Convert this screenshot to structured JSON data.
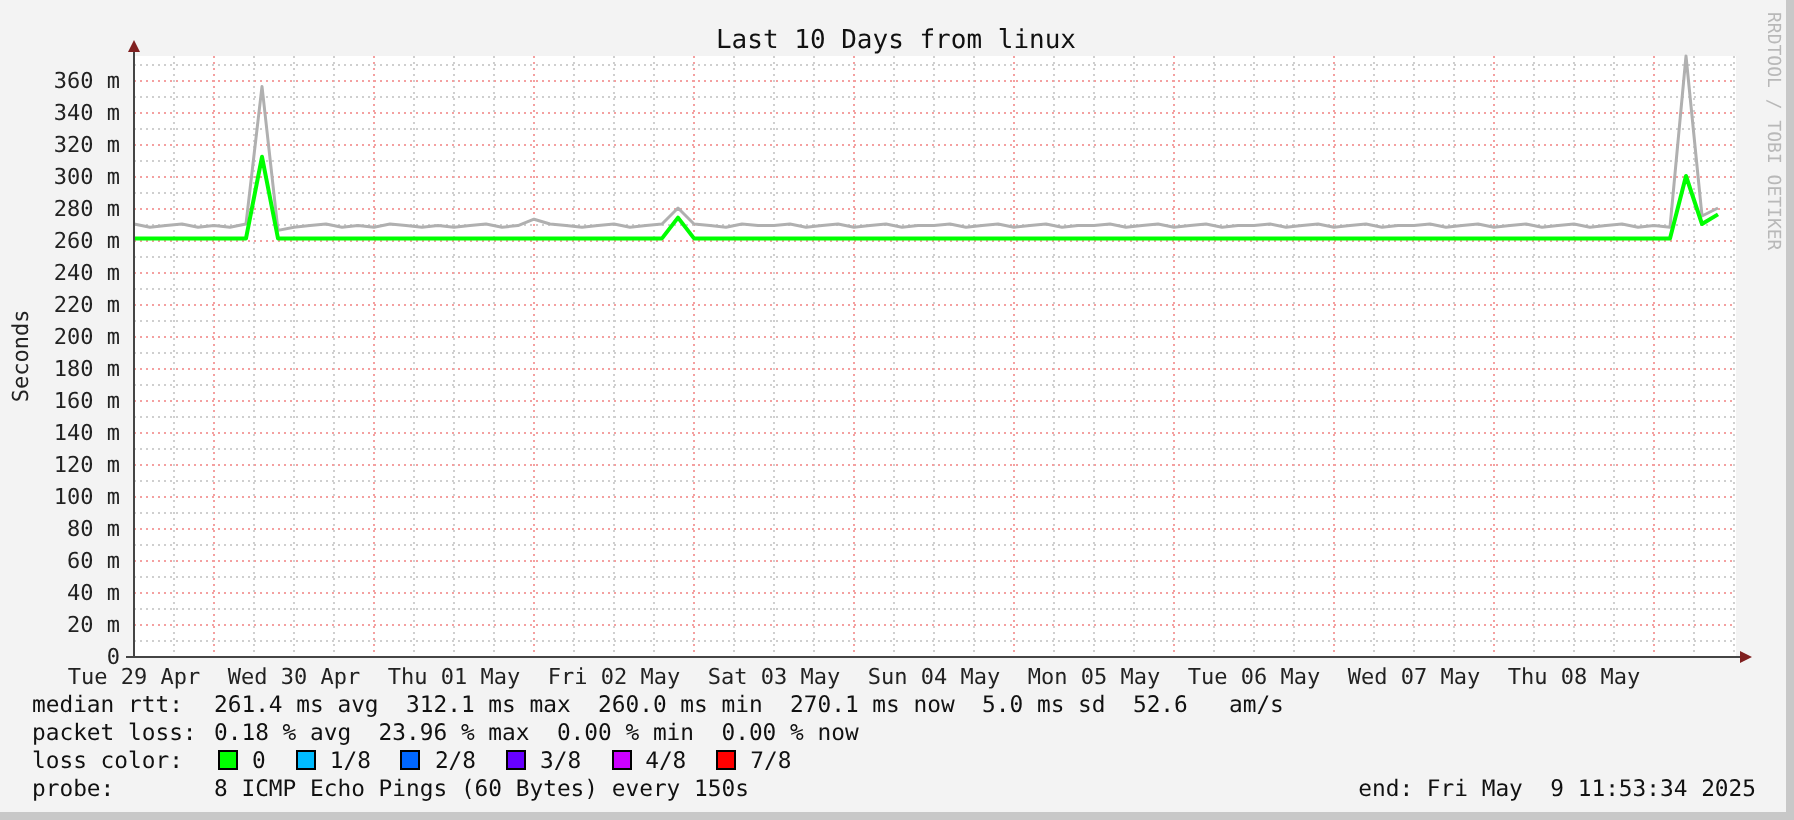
{
  "title": "Last 10 Days from linux",
  "side_label": "RRDTOOL / TOBI OETIKER",
  "chart": {
    "chart_data": {
      "type": "line",
      "grid": true,
      "ylabel": "Seconds",
      "ylim": [
        0,
        375
      ],
      "yticks": [
        {
          "value": 0,
          "label": "0"
        },
        {
          "value": 20,
          "label": "20 m"
        },
        {
          "value": 40,
          "label": "40 m"
        },
        {
          "value": 60,
          "label": "60 m"
        },
        {
          "value": 80,
          "label": "80 m"
        },
        {
          "value": 100,
          "label": "100 m"
        },
        {
          "value": 120,
          "label": "120 m"
        },
        {
          "value": 140,
          "label": "140 m"
        },
        {
          "value": 160,
          "label": "160 m"
        },
        {
          "value": 180,
          "label": "180 m"
        },
        {
          "value": 200,
          "label": "200 m"
        },
        {
          "value": 220,
          "label": "220 m"
        },
        {
          "value": 240,
          "label": "240 m"
        },
        {
          "value": 260,
          "label": "260 m"
        },
        {
          "value": 280,
          "label": "280 m"
        },
        {
          "value": 300,
          "label": "300 m"
        },
        {
          "value": 320,
          "label": "320 m"
        },
        {
          "value": 340,
          "label": "340 m"
        },
        {
          "value": 360,
          "label": "360 m"
        }
      ],
      "categories": [
        "Tue 29 Apr",
        null,
        null,
        null,
        null,
        null,
        null,
        null,
        null,
        null,
        "Wed 30 Apr",
        null,
        null,
        null,
        null,
        null,
        null,
        null,
        null,
        null,
        "Thu 01 May",
        null,
        null,
        null,
        null,
        null,
        null,
        null,
        null,
        null,
        "Fri 02 May",
        null,
        null,
        null,
        null,
        null,
        null,
        null,
        null,
        null,
        "Sat 03 May",
        null,
        null,
        null,
        null,
        null,
        null,
        null,
        null,
        null,
        "Sun 04 May",
        null,
        null,
        null,
        null,
        null,
        null,
        null,
        null,
        null,
        "Mon 05 May",
        null,
        null,
        null,
        null,
        null,
        null,
        null,
        null,
        null,
        "Tue 06 May",
        null,
        null,
        null,
        null,
        null,
        null,
        null,
        null,
        null,
        "Wed 07 May",
        null,
        null,
        null,
        null,
        null,
        null,
        null,
        null,
        null,
        "Thu 08 May",
        null,
        null,
        null,
        null,
        null,
        null,
        null,
        null,
        null
      ],
      "series": [
        {
          "color": "#b0b0b0",
          "values": [
            270,
            268,
            269,
            270,
            268,
            269,
            268,
            270,
            356,
            266,
            268,
            269,
            270,
            268,
            269,
            268,
            270,
            269,
            268,
            269,
            268,
            269,
            270,
            268,
            269,
            273,
            270,
            269,
            268,
            269,
            270,
            268,
            269,
            270,
            280,
            270,
            269,
            268,
            270,
            269,
            269,
            270,
            268,
            269,
            270,
            268,
            269,
            270,
            268,
            269,
            269,
            270,
            268,
            269,
            270,
            268,
            269,
            270,
            268,
            269,
            269,
            270,
            268,
            269,
            270,
            268,
            269,
            270,
            268,
            269,
            269,
            270,
            268,
            269,
            270,
            268,
            269,
            270,
            268,
            269,
            269,
            270,
            268,
            269,
            270,
            268,
            269,
            270,
            268,
            269,
            270,
            268,
            269,
            270,
            268,
            269,
            268,
            375,
            275,
            280
          ]
        },
        {
          "color": "#00ff00",
          "values": [
            261,
            261,
            261,
            261,
            261,
            261,
            261,
            261,
            312,
            261,
            261,
            261,
            261,
            261,
            261,
            261,
            261,
            261,
            261,
            261,
            261,
            261,
            261,
            261,
            261,
            261,
            261,
            261,
            261,
            261,
            261,
            261,
            261,
            261,
            274,
            261,
            261,
            261,
            261,
            261,
            261,
            261,
            261,
            261,
            261,
            261,
            261,
            261,
            261,
            261,
            261,
            261,
            261,
            261,
            261,
            261,
            261,
            261,
            261,
            261,
            261,
            261,
            261,
            261,
            261,
            261,
            261,
            261,
            261,
            261,
            261,
            261,
            261,
            261,
            261,
            261,
            261,
            261,
            261,
            261,
            261,
            261,
            261,
            261,
            261,
            261,
            261,
            261,
            261,
            261,
            261,
            261,
            261,
            261,
            261,
            261,
            261,
            300,
            270,
            276
          ]
        }
      ]
    }
  },
  "legend": {
    "median_rtt": {
      "label": "median rtt:",
      "value": "261.4 ms avg  312.1 ms max  260.0 ms min  270.1 ms now  5.0 ms sd  52.6   am/s"
    },
    "packet_loss": {
      "label": "packet loss:",
      "value": "0.18 % avg  23.96 % max  0.00 % min  0.00 % now"
    },
    "loss_color": {
      "label": "loss color:",
      "items": [
        {
          "label": "0",
          "color": "#00ff00"
        },
        {
          "label": "1/8",
          "color": "#00bbff"
        },
        {
          "label": "2/8",
          "color": "#0066ff"
        },
        {
          "label": "3/8",
          "color": "#6600ff"
        },
        {
          "label": "4/8",
          "color": "#cc00ff"
        },
        {
          "label": "7/8",
          "color": "#ff0000"
        }
      ]
    },
    "probe": {
      "label": "probe:",
      "value": "8 ICMP Echo Pings (60 Bytes) every 150s"
    },
    "end": "end: Fri May  9 11:53:34 2025"
  }
}
